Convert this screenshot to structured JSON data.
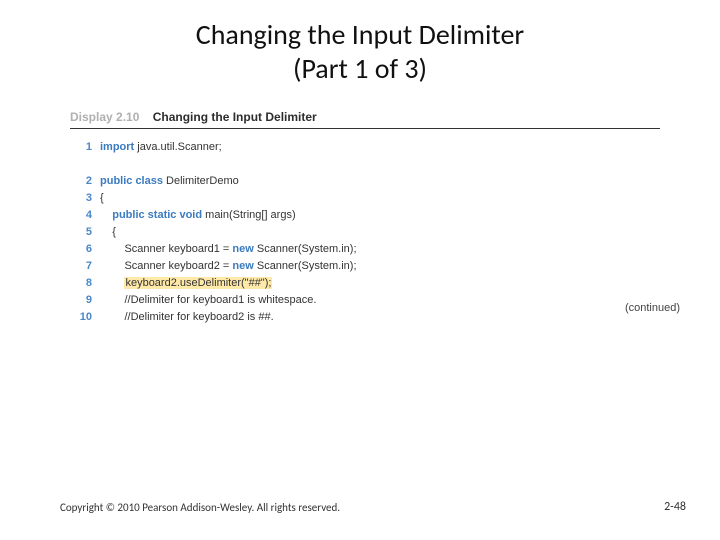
{
  "title_line1": "Changing the Input Delimiter",
  "title_line2": "(Part 1 of 3)",
  "display": {
    "label": "Display 2.10",
    "title": "Changing the Input Delimiter"
  },
  "code": {
    "lines": [
      {
        "n": "1",
        "indent": "",
        "tokens": [
          [
            "kw",
            "import"
          ],
          [
            "plain",
            " java.util.Scanner;"
          ]
        ]
      },
      {
        "n": "",
        "indent": "",
        "tokens": []
      },
      {
        "n": "2",
        "indent": "",
        "tokens": [
          [
            "kw",
            "public class"
          ],
          [
            "plain",
            " DelimiterDemo"
          ]
        ]
      },
      {
        "n": "3",
        "indent": "",
        "tokens": [
          [
            "plain",
            "{"
          ]
        ]
      },
      {
        "n": "4",
        "indent": "    ",
        "tokens": [
          [
            "kw",
            "public static void"
          ],
          [
            "plain",
            " main(String[] args)"
          ]
        ]
      },
      {
        "n": "5",
        "indent": "    ",
        "tokens": [
          [
            "plain",
            "{"
          ]
        ]
      },
      {
        "n": "6",
        "indent": "        ",
        "tokens": [
          [
            "plain",
            "Scanner keyboard1 = "
          ],
          [
            "kw",
            "new"
          ],
          [
            "plain",
            " Scanner(System.in);"
          ]
        ]
      },
      {
        "n": "7",
        "indent": "        ",
        "tokens": [
          [
            "plain",
            "Scanner keyboard2 = "
          ],
          [
            "kw",
            "new"
          ],
          [
            "plain",
            " Scanner(System.in);"
          ]
        ]
      },
      {
        "n": "8",
        "indent": "        ",
        "tokens": [
          [
            "hi",
            "keyboard2.useDelimiter(\"##\");"
          ]
        ]
      },
      {
        "n": "9",
        "indent": "        ",
        "tokens": [
          [
            "plain",
            "//Delimiter for keyboard1 is whitespace."
          ]
        ]
      },
      {
        "n": "10",
        "indent": "        ",
        "tokens": [
          [
            "plain",
            "//Delimiter for keyboard2 is ##."
          ]
        ]
      }
    ]
  },
  "continued": "(continued)",
  "footer": "Copyright © 2010 Pearson Addison-Wesley. All rights reserved.",
  "pagenum": "2-48"
}
